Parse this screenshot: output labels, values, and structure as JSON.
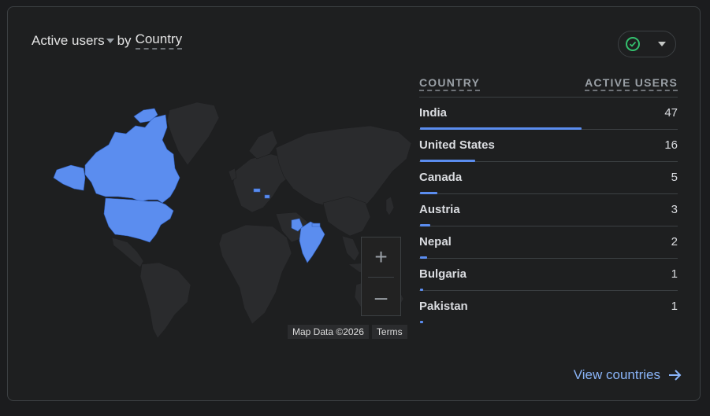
{
  "header": {
    "metric": "Active users",
    "by": "by",
    "dimension": "Country"
  },
  "status_icon": "check-circle-icon",
  "map": {
    "attribution": "Map Data ©2026",
    "terms": "Terms",
    "zoom_in": "+",
    "zoom_out": "–"
  },
  "table": {
    "col_country": "COUNTRY",
    "col_users": "ACTIVE USERS",
    "rows": [
      {
        "country": "India",
        "users": "47"
      },
      {
        "country": "United States",
        "users": "16"
      },
      {
        "country": "Canada",
        "users": "5"
      },
      {
        "country": "Austria",
        "users": "3"
      },
      {
        "country": "Nepal",
        "users": "2"
      },
      {
        "country": "Bulgaria",
        "users": "1"
      },
      {
        "country": "Pakistan",
        "users": "1"
      }
    ]
  },
  "link": {
    "view_countries": "View countries"
  },
  "colors": {
    "highlight": "#5b8def",
    "link": "#8ab4f8",
    "success": "#34c06e"
  }
}
